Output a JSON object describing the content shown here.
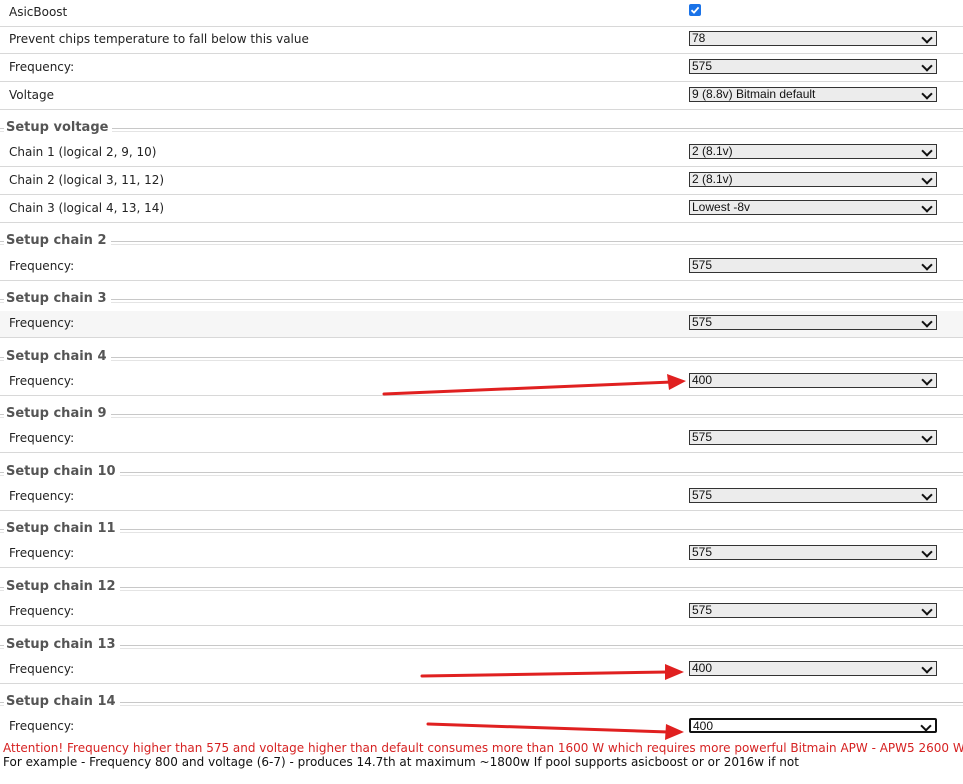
{
  "general": {
    "asicboost_label": "AsicBoost",
    "asicboost_checked": true,
    "temp_label": "Prevent chips temperature to fall below this value",
    "temp_value": "78",
    "freq_label": "Frequency:",
    "freq_value": "575",
    "voltage_label": "Voltage",
    "voltage_value": "9 (8.8v) Bitmain default"
  },
  "setup_voltage": {
    "title": "Setup voltage",
    "chains": [
      {
        "label": "Chain 1 (logical 2, 9, 10)",
        "value": "2 (8.1v)"
      },
      {
        "label": "Chain 2 (logical 3, 11, 12)",
        "value": "2 (8.1v)"
      },
      {
        "label": "Chain 3 (logical 4, 13, 14)",
        "value": "Lowest -8v"
      }
    ]
  },
  "chain_sections": [
    {
      "title": "Setup chain 2",
      "label": "Frequency:",
      "value": "575"
    },
    {
      "title": "Setup chain 3",
      "label": "Frequency:",
      "value": "575"
    },
    {
      "title": "Setup chain 4",
      "label": "Frequency:",
      "value": "400"
    },
    {
      "title": "Setup chain 9",
      "label": "Frequency:",
      "value": "575"
    },
    {
      "title": "Setup chain 10",
      "label": "Frequency:",
      "value": "575"
    },
    {
      "title": "Setup chain 11",
      "label": "Frequency:",
      "value": "575"
    },
    {
      "title": "Setup chain 12",
      "label": "Frequency:",
      "value": "575"
    },
    {
      "title": "Setup chain 13",
      "label": "Frequency:",
      "value": "400"
    },
    {
      "title": "Setup chain 14",
      "label": "Frequency:",
      "value": "400"
    }
  ],
  "notes": {
    "warning": "Attention! Frequency higher than 575 and voltage higher than default consumes more than 1600 W which requires more powerful Bitmain APW - APW5 2600 W",
    "example": "For example - Frequency 800 and voltage (6-7) - produces 14.7th at maximum ~1800w If pool supports asicboost or or 2016w if not"
  },
  "colors": {
    "warning_text": "#d62222",
    "annotation_arrow": "#e02020",
    "checkbox": "#1a73e8",
    "section_title": "#555555"
  }
}
